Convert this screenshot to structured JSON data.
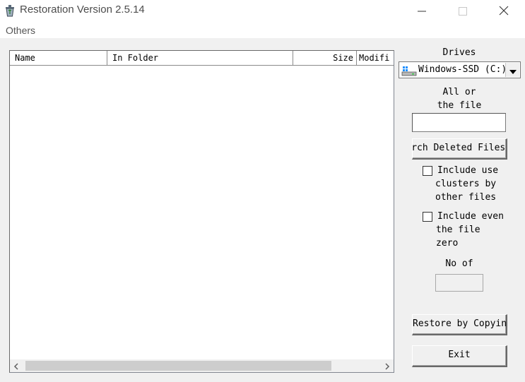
{
  "window": {
    "title": "Restoration Version 2.5.14"
  },
  "menu": {
    "items": [
      "Others"
    ]
  },
  "list": {
    "columns": {
      "name": "Name",
      "folder": "In Folder",
      "size": "Size",
      "modified": "Modifi"
    },
    "rows": []
  },
  "panel": {
    "drives_label": "Drives",
    "drive_selected": "Windows-SSD (C:)",
    "filter_label_line1": "All or",
    "filter_label_line2": "the file",
    "filter_value": "",
    "search_button": "Search Deleted Files",
    "include_used_clusters": {
      "line1": "Include use",
      "line2": "clusters by",
      "line3": "other files",
      "checked": false
    },
    "include_zero_files": {
      "line1": "Include even",
      "line2": "the file",
      "line3": "zero",
      "checked": false
    },
    "count_label": "No of",
    "count_value": "",
    "restore_button": "Restore by Copying",
    "exit_button": "Exit"
  },
  "colors": {
    "window_bg": "#f0f0f0",
    "list_bg": "#ffffff",
    "border_dark": "#696969"
  }
}
